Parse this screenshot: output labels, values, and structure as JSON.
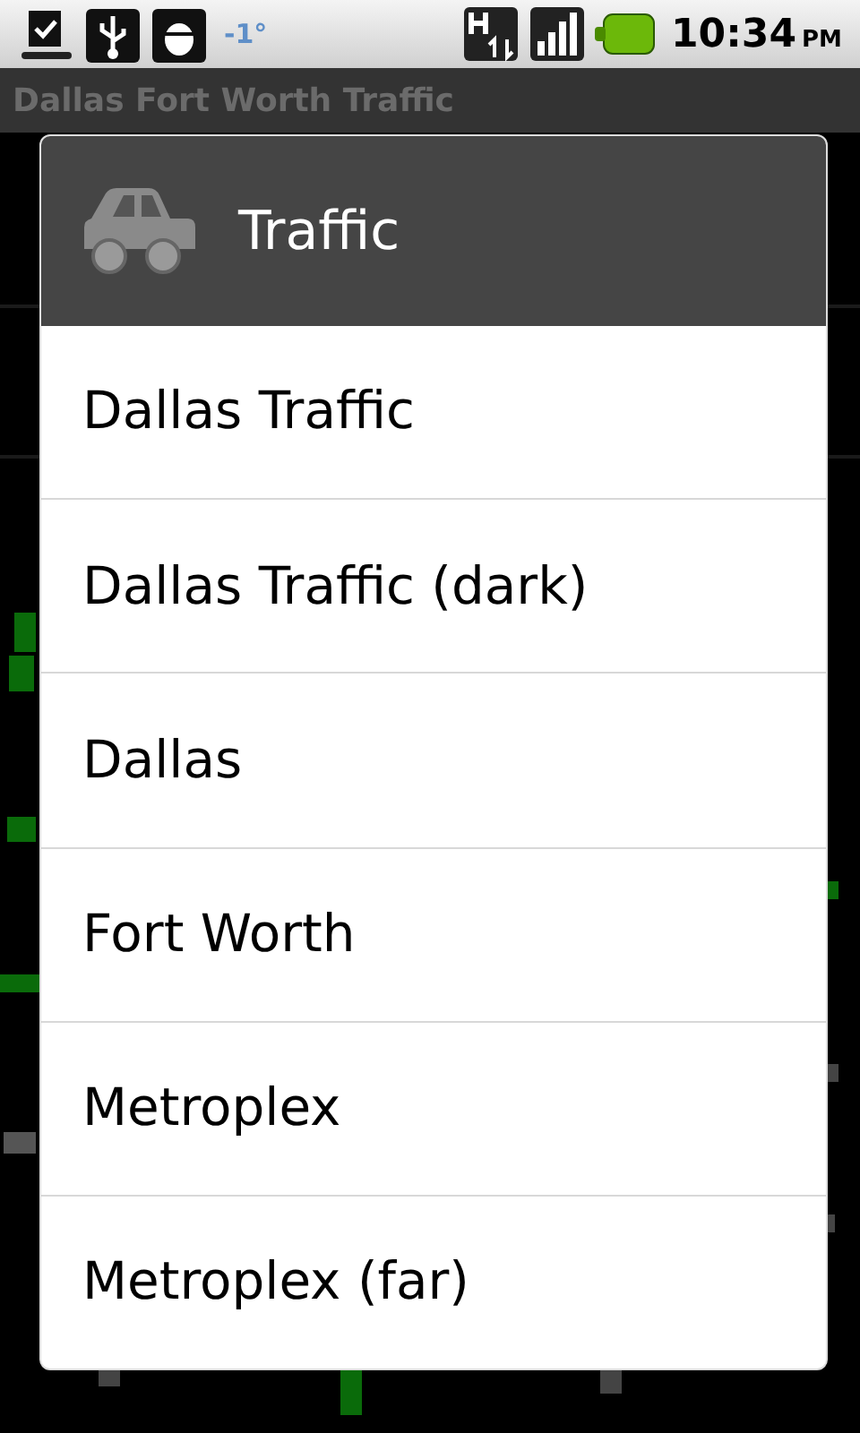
{
  "status_bar": {
    "temperature": "-1°",
    "time": "10:34",
    "period": "PM"
  },
  "app_title": "Dallas Fort Worth Traffic",
  "dialog": {
    "title": "Traffic",
    "items": [
      {
        "label": "Dallas Traffic"
      },
      {
        "label": "Dallas Traffic (dark)"
      },
      {
        "label": "Dallas"
      },
      {
        "label": "Fort Worth"
      },
      {
        "label": "Metroplex"
      },
      {
        "label": "Metroplex (far)"
      }
    ]
  }
}
